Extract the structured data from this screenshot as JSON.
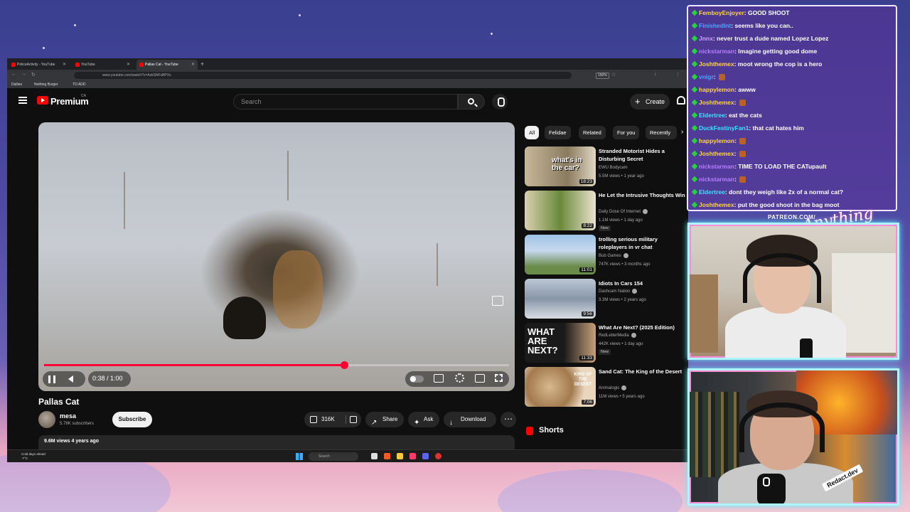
{
  "browser": {
    "tabs": [
      {
        "label": "PoliceActivity - YouTube",
        "active": false
      },
      {
        "label": "YouTube",
        "active": false
      },
      {
        "label": "Pallas Cat - YouTube",
        "active": true
      }
    ],
    "url": "www.youtube.com/watch?v=AzkSNFvBPXs",
    "zoom": "150%",
    "bookmarks": [
      "Dailies",
      "Nothing Burger",
      "TO ADD"
    ]
  },
  "yt": {
    "brand": "Premium",
    "region": "CA",
    "search_placeholder": "Search",
    "create_label": "Create"
  },
  "player": {
    "current_time": "0:38 / 1:00",
    "progress_fraction": 0.645
  },
  "video": {
    "title": "Pallas Cat",
    "channel": "mesa",
    "subscribers": "5.78K subscribers",
    "subscribe_label": "Subscribe",
    "likes": "316K",
    "share_label": "Share",
    "ask_label": "Ask",
    "download_label": "Download",
    "views_date": "9.6M views  4 years ago"
  },
  "chips": [
    "All",
    "Felidae",
    "Related",
    "For you",
    "Recently"
  ],
  "recommendations": [
    {
      "title": "Stranded Motorist Hides a Disturbing Secret",
      "channel": "EWU Bodycam",
      "verified": false,
      "meta": "5.5M views • 1 year ago",
      "duration": "18:23",
      "new": false,
      "thumb_text": "what's in the car?"
    },
    {
      "title": "He Let the Intrusive Thoughts Win",
      "channel": "Daily Dose Of Internet",
      "verified": true,
      "meta": "1.1M views • 1 day ago",
      "duration": "8:22",
      "new": true,
      "thumb_text": ""
    },
    {
      "title": "trolling serious military roleplayers in vr chat",
      "channel": "Bub Games",
      "verified": true,
      "meta": "747K views • 3 months ago",
      "duration": "11:01",
      "new": false,
      "thumb_text": ""
    },
    {
      "title": "Idiots In Cars 154",
      "channel": "Dashcam Nation",
      "verified": true,
      "meta": "3.3M views • 2 years ago",
      "duration": "9:56",
      "new": false,
      "thumb_text": ""
    },
    {
      "title": "What Are Next? (2025 Edition)",
      "channel": "RedLetterMedia",
      "verified": true,
      "meta": "442K views • 1 day ago",
      "duration": "11:33",
      "new": true,
      "thumb_text": "WHAT ARE NEXT?"
    },
    {
      "title": "Sand Cat: The King of the Desert",
      "channel": "Animalogic",
      "verified": true,
      "meta": "11M views • 5 years ago",
      "duration": "7:06",
      "new": false,
      "thumb_text": "KING OF THE DESERT"
    }
  ],
  "new_label": "New",
  "shorts_title": "Shorts",
  "taskbar": {
    "weather": "Cold days ahead",
    "temp": "-7°C",
    "search_label": "Search"
  },
  "chat": [
    {
      "user": "FemboyEnjoyer",
      "text": "GOOD SHOOT",
      "color": "#ffd447"
    },
    {
      "user": "FinishedInt",
      "text": "seems like you can..",
      "color": "#4aa3ff"
    },
    {
      "user": "Jnnx",
      "text": "never trust a dude named Lopez Lopez",
      "color": "#c9a4ff"
    },
    {
      "user": "nickstarman",
      "text": "Imagine getting good dome",
      "color": "#b87cff"
    },
    {
      "user": "Joshthemex",
      "text": "moot wrong the cop is a hero",
      "color": "#ffd447"
    },
    {
      "user": "vnlgr",
      "text": "",
      "color": "#4aa3ff"
    },
    {
      "user": "happylemon",
      "text": "awww",
      "color": "#ffd447"
    },
    {
      "user": "Joshthemex",
      "text": "",
      "color": "#ffd447"
    },
    {
      "user": "Eldertree",
      "text": "eat the cats",
      "color": "#3ee0ff"
    },
    {
      "user": "DuckFestinyFan1",
      "text": "that cat hates him",
      "color": "#3ee0ff"
    },
    {
      "user": "happylemon",
      "text": "",
      "color": "#ffd447"
    },
    {
      "user": "Joshthemex",
      "text": "",
      "color": "#ffd447"
    },
    {
      "user": "nickstarman",
      "text": "TIME TO LOAD THE CATupault",
      "color": "#b87cff"
    },
    {
      "user": "nickstarman",
      "text": "",
      "color": "#b87cff"
    },
    {
      "user": "Eldertree",
      "text": "dont they weigh like 2x of a normal cat?",
      "color": "#3ee0ff"
    },
    {
      "user": "Joshthemex",
      "text": "put the good shoot in the bag moot",
      "color": "#ffd447"
    }
  ],
  "overlay": {
    "patreon": "PATREON.COM/",
    "signature": "Anything Else",
    "cam_tag": "Redact.dev"
  },
  "colors": {
    "yt_red": "#ff0000",
    "progress": "#ff0033",
    "cam_border": "#aef5ff"
  }
}
